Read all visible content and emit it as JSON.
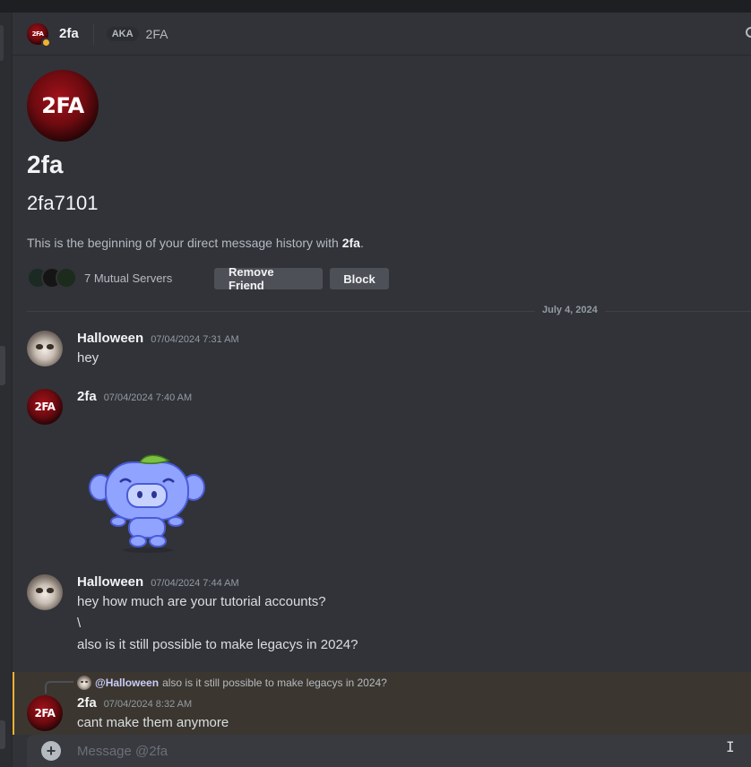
{
  "header": {
    "avatar_text": "2FA",
    "name": "2fa",
    "aka_label": "AKA",
    "aka_name": "2FA"
  },
  "intro": {
    "avatar_text": "2FA",
    "display_name": "2fa",
    "username": "2fa7101",
    "desc_prefix": "This is the beginning of your direct message history with ",
    "desc_name": "2fa",
    "desc_suffix": ".",
    "mutual_servers": "7 Mutual Servers",
    "remove_friend": "Remove Friend",
    "block": "Block"
  },
  "date_divider": "July 4, 2024",
  "messages": [
    {
      "author": "Halloween",
      "timestamp": "07/04/2024 7:31 AM",
      "lines": [
        "hey"
      ]
    },
    {
      "author": "2fa",
      "timestamp": "07/04/2024 7:40 AM",
      "avatar_text": "2FA",
      "lines": []
    },
    {
      "author": "Halloween",
      "timestamp": "07/04/2024 7:44 AM",
      "lines": [
        "hey how much are your tutorial accounts?",
        "\\",
        "also is it still possible to make legacys in 2024?"
      ]
    },
    {
      "author": "2fa",
      "timestamp": "07/04/2024 8:32 AM",
      "avatar_text": "2FA",
      "lines": [
        "cant make them anymore"
      ]
    }
  ],
  "reply": {
    "author": "@Halloween",
    "text": "also is it still possible to make legacys in 2024?"
  },
  "composer": {
    "plus": "+",
    "placeholder": "Message @2fa"
  },
  "colors": {
    "background": "#313338",
    "mention_highlight": "#3b3730",
    "mention_bar": "#f0b232",
    "status_idle": "#f0b232"
  }
}
